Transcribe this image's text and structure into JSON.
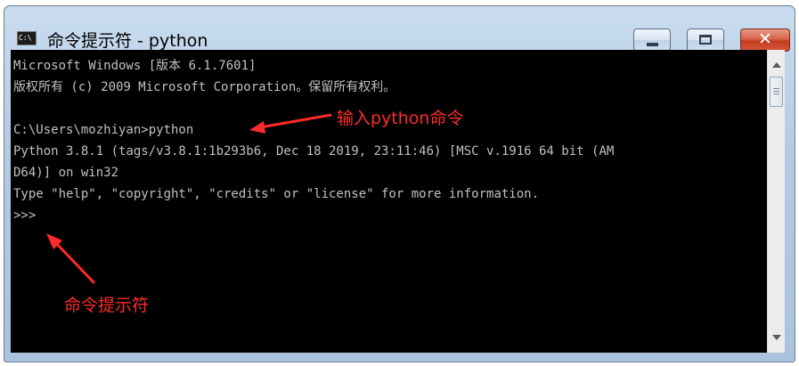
{
  "window": {
    "title": "命令提示符 - python",
    "icon_text": "C:\\"
  },
  "controls": {
    "minimize": "minimize",
    "maximize": "maximize",
    "close": "✕"
  },
  "console": {
    "lines": [
      "Microsoft Windows [版本 6.1.7601]",
      "版权所有 (c) 2009 Microsoft Corporation。保留所有权利。",
      "",
      "C:\\Users\\mozhiyan>python",
      "Python 3.8.1 (tags/v3.8.1:1b293b6, Dec 18 2019, 23:11:46) [MSC v.1916 64 bit (AM",
      "D64)] on win32",
      "Type \"help\", \"copyright\", \"credits\" or \"license\" for more information.",
      ">>>"
    ]
  },
  "annotations": {
    "input_hint": "输入python命令",
    "prompt_hint": "命令提示符",
    "color": "#ff2a2a"
  },
  "colors": {
    "console_bg": "#000000",
    "console_text": "#c0c0c0",
    "titlebar": "#b4cbe4",
    "close_button": "#c43a1e"
  }
}
